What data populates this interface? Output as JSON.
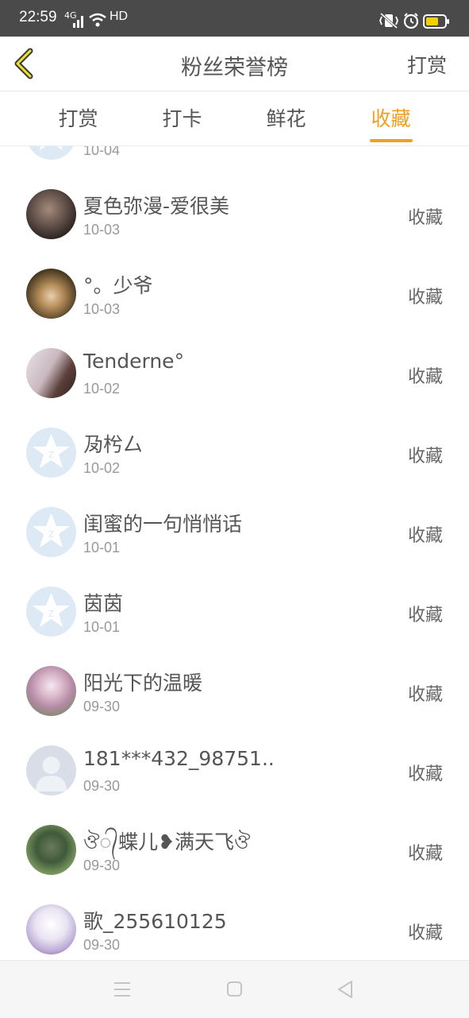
{
  "status_bar": {
    "time": "22:59",
    "network": "4G",
    "hd": "HD",
    "icons": [
      "signal-icon",
      "wifi-icon",
      "vibrate-icon",
      "alarm-icon",
      "battery-icon"
    ]
  },
  "header": {
    "title": "粉丝荣誉榜",
    "right_action": "打赏",
    "back_icon": "chevron-left-icon"
  },
  "tabs": [
    {
      "label": "打赏",
      "active": false
    },
    {
      "label": "打卡",
      "active": false
    },
    {
      "label": "鲜花",
      "active": false
    },
    {
      "label": "收藏",
      "active": true
    }
  ],
  "accent_color": "#f0a020",
  "list": {
    "partial_top_date": "10-04",
    "items": [
      {
        "name": "夏色弥漫-爱很美",
        "date": "10-03",
        "action": "收藏",
        "avatar": "photo"
      },
      {
        "name": "°。少爷",
        "date": "10-03",
        "action": "收藏",
        "avatar": "photo"
      },
      {
        "name": "Tenderne°",
        "date": "10-02",
        "action": "收藏",
        "avatar": "photo"
      },
      {
        "name": "夃枍厶",
        "date": "10-02",
        "action": "收藏",
        "avatar": "default-star"
      },
      {
        "name": "闺蜜的一句悄悄话",
        "date": "10-01",
        "action": "收藏",
        "avatar": "default-star"
      },
      {
        "name": "茵茵",
        "date": "10-01",
        "action": "收藏",
        "avatar": "default-star"
      },
      {
        "name": "阳光下的温暖",
        "date": "09-30",
        "action": "收藏",
        "avatar": "photo"
      },
      {
        "name": "181***432_98751...",
        "date": "09-30",
        "action": "收藏",
        "avatar": "default-person"
      },
      {
        "name": "ঔ᭄蝶儿❥满天飞ঔ",
        "date": "09-30",
        "action": "收藏",
        "avatar": "photo"
      },
      {
        "name": "歌_255610125",
        "date": "09-30",
        "action": "收藏",
        "avatar": "photo"
      }
    ]
  },
  "nav_bar": {
    "buttons": [
      "menu-icon",
      "home-icon",
      "back-triangle-icon"
    ]
  }
}
